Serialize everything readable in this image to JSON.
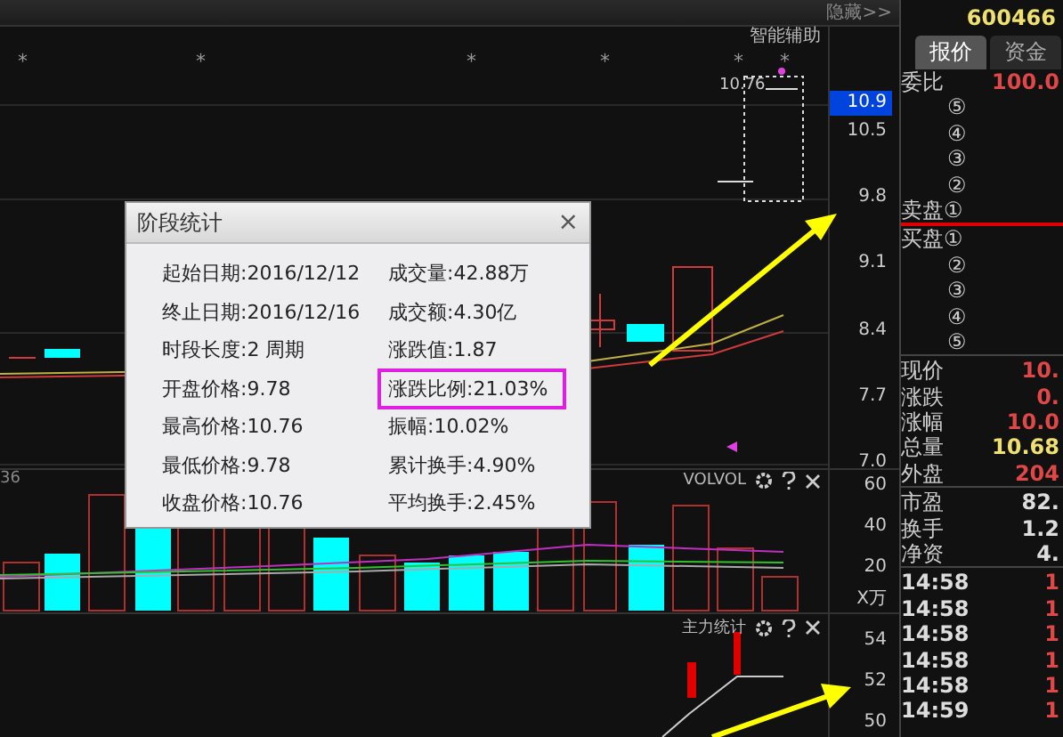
{
  "toolbar": {
    "hide_button": "隐藏>>"
  },
  "main_chart": {
    "markers": [
      "*",
      "*",
      "*",
      "*",
      "*",
      "*"
    ],
    "assist_label": "智能辅助",
    "price_label": "10.76",
    "axis": [
      {
        "label": "10.9",
        "selected": true
      },
      {
        "label": "10.5",
        "selected": false
      },
      {
        "label": "9.8",
        "selected": false
      },
      {
        "label": "9.1",
        "selected": false
      },
      {
        "label": "8.4",
        "selected": false
      },
      {
        "label": "7.7",
        "selected": false
      },
      {
        "label": "7.0",
        "selected": false
      }
    ]
  },
  "volume_panel": {
    "left_label": "36",
    "title": "VOLVOL",
    "axis": [
      "60",
      "40",
      "20"
    ],
    "unit": "X万"
  },
  "force_panel": {
    "title": "主力统计",
    "axis": [
      "54",
      "52",
      "50"
    ]
  },
  "popup": {
    "title": "阶段统计",
    "close": "×",
    "rows": [
      {
        "cells": [
          {
            "text": "起始日期:2016/12/12",
            "highlighted": false
          },
          {
            "text": "成交量:42.88万",
            "highlighted": false
          }
        ]
      },
      {
        "cells": [
          {
            "text": "终止日期:2016/12/16",
            "highlighted": false
          },
          {
            "text": "成交额:4.30亿",
            "highlighted": false
          }
        ]
      },
      {
        "cells": [
          {
            "text": "时段长度:2 周期",
            "highlighted": false
          },
          {
            "text": "涨跌值:1.87",
            "highlighted": false
          }
        ]
      },
      {
        "cells": [
          {
            "text": "开盘价格:9.78",
            "highlighted": false
          },
          {
            "text": "涨跌比例:21.03%",
            "highlighted": true
          }
        ]
      },
      {
        "cells": [
          {
            "text": "最高价格:10.76",
            "highlighted": false
          },
          {
            "text": "振幅:10.02%",
            "highlighted": false
          }
        ]
      },
      {
        "cells": [
          {
            "text": "最低价格:9.78",
            "highlighted": false
          },
          {
            "text": "累计换手:4.90%",
            "highlighted": false
          }
        ]
      },
      {
        "cells": [
          {
            "text": "收盘价格:10.76",
            "highlighted": false
          },
          {
            "text": "平均换手:2.45%",
            "highlighted": false
          }
        ]
      }
    ]
  },
  "quote_panel": {
    "code": "600466",
    "tabs": [
      {
        "label": "报价",
        "selected": true
      },
      {
        "label": "资金",
        "selected": false
      }
    ],
    "ratio": {
      "label": "委比",
      "value": "100.0"
    },
    "sell_orders": [
      "⑤",
      "④",
      "③",
      "②",
      "卖盘①"
    ],
    "buy_orders": [
      "买盘①",
      "②",
      "③",
      "④",
      "⑤"
    ],
    "quotes": [
      {
        "label": "现价",
        "value": "10.",
        "color": "#e04848"
      },
      {
        "label": "涨跌",
        "value": "0.",
        "color": "#e04848"
      },
      {
        "label": "涨幅",
        "value": "10.0",
        "color": "#e04848"
      },
      {
        "label": "总量",
        "value": "10.68",
        "color": "#f0e070"
      },
      {
        "label": "外盘",
        "value": "204",
        "color": "#e04848"
      }
    ],
    "stats": [
      {
        "label": "市盈",
        "value": "82."
      },
      {
        "label": "换手",
        "value": "1.2"
      },
      {
        "label": "净资",
        "value": "4."
      }
    ],
    "trades": [
      {
        "time": "14:58",
        "value": "1"
      },
      {
        "time": "14:58",
        "value": "1"
      },
      {
        "time": "14:58",
        "value": "1"
      },
      {
        "time": "14:58",
        "value": "1"
      },
      {
        "time": "14:58",
        "value": "1"
      },
      {
        "time": "14:59",
        "value": "1"
      }
    ]
  }
}
